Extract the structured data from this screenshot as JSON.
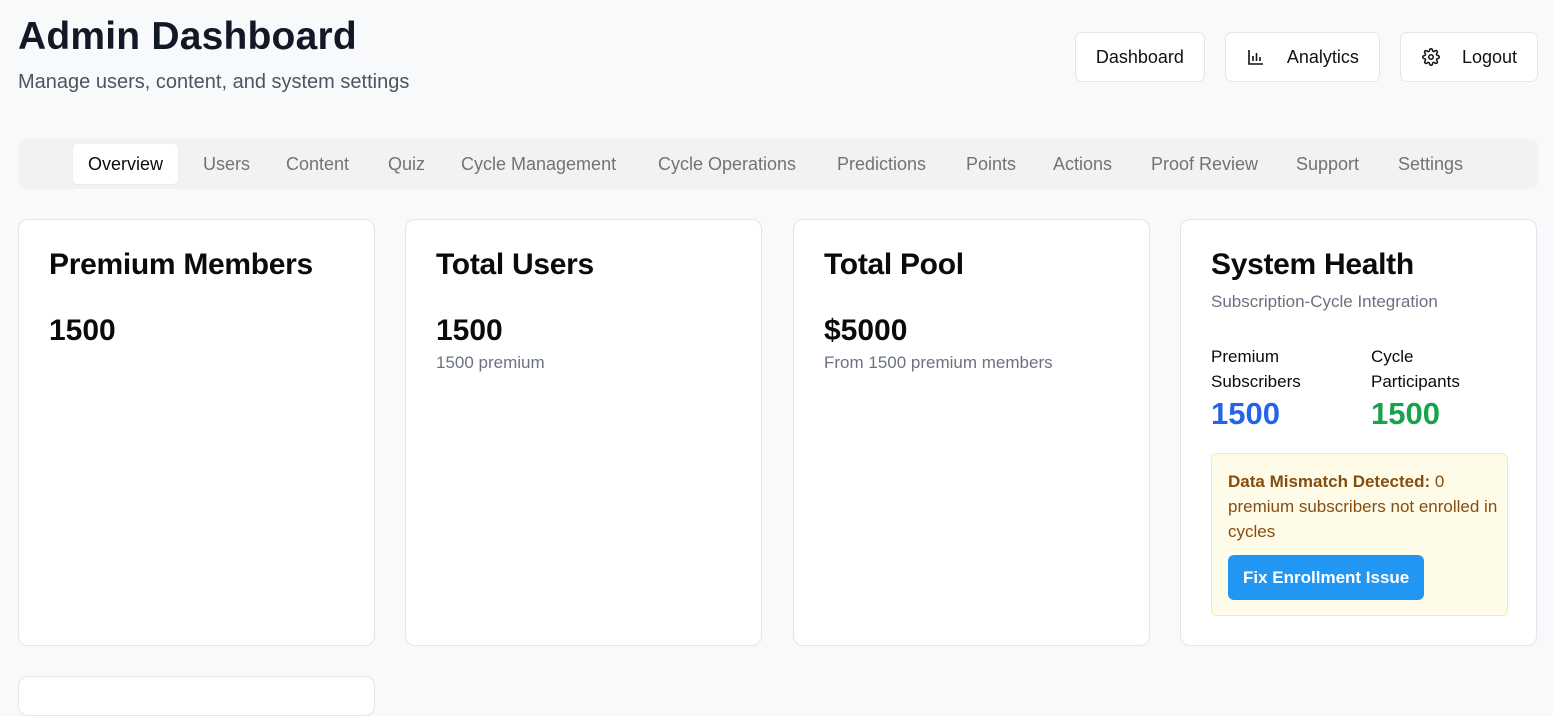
{
  "header": {
    "title": "Admin Dashboard",
    "subtitle": "Manage users, content, and system settings"
  },
  "top_buttons": {
    "dashboard": "Dashboard",
    "analytics": "Analytics",
    "logout": "Logout"
  },
  "tabs": [
    {
      "label": "Overview",
      "active": true
    },
    {
      "label": "Users"
    },
    {
      "label": "Content"
    },
    {
      "label": "Quiz"
    },
    {
      "label": "Cycle Management"
    },
    {
      "label": "Cycle Operations"
    },
    {
      "label": "Predictions"
    },
    {
      "label": "Points"
    },
    {
      "label": "Actions"
    },
    {
      "label": "Proof Review"
    },
    {
      "label": "Support"
    },
    {
      "label": "Settings"
    }
  ],
  "cards": {
    "premium": {
      "title": "Premium Members",
      "value": "1500"
    },
    "users": {
      "title": "Total Users",
      "value": "1500",
      "sub": "1500 premium"
    },
    "pool": {
      "title": "Total Pool",
      "value": "$5000",
      "sub": "From 1500 premium members"
    },
    "health": {
      "title": "System Health",
      "subtitle": "Subscription-Cycle Integration",
      "premium_label": "Premium Subscribers",
      "premium_value": "1500",
      "cycle_label": "Cycle Participants",
      "cycle_value": "1500",
      "alert_title": "Data Mismatch Detected:",
      "alert_text": " 0 premium subscribers not enrolled in cycles",
      "fix_button": "Fix Enrollment Issue"
    }
  },
  "colors": {
    "premium_value": "#2563eb",
    "cycle_value": "#16a34a",
    "fix_button": "#2196f3"
  }
}
